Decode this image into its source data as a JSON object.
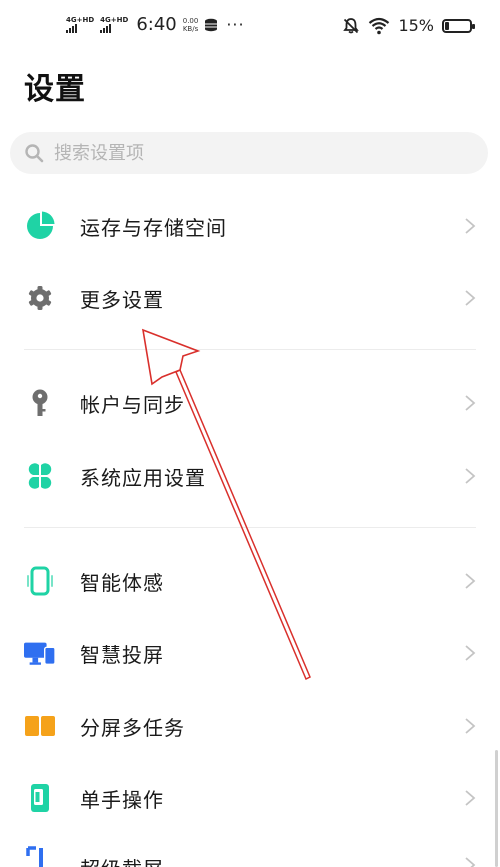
{
  "status_bar": {
    "sim1": "4G+HD",
    "sim2": "4G+HD",
    "time": "6:40",
    "speed_value": "0.00",
    "speed_unit": "KB/s",
    "more": "···",
    "battery_pct": "15%",
    "battery_level": 0.15
  },
  "page": {
    "title": "设置"
  },
  "search": {
    "placeholder": "搜索设置项"
  },
  "menu": {
    "items": [
      {
        "label": "运存与存储空间",
        "icon": "pie-chart-icon",
        "color": "#1fd3a5"
      },
      {
        "label": "更多设置",
        "icon": "gear-icon",
        "color": "#6e6e6e"
      },
      {
        "label": "帐户与同步",
        "icon": "key-icon",
        "color": "#6e6e6e"
      },
      {
        "label": "系统应用设置",
        "icon": "clover-apps-icon",
        "color": "#1fd3a5"
      },
      {
        "label": "智能体感",
        "icon": "phone-outline-icon",
        "color": "#1fd3a5"
      },
      {
        "label": "智慧投屏",
        "icon": "cast-screen-icon",
        "color": "#2f6ff0"
      },
      {
        "label": "分屏多任务",
        "icon": "split-screen-icon",
        "color": "#f5a21a"
      },
      {
        "label": "单手操作",
        "icon": "one-hand-icon",
        "color": "#1fd3a5"
      },
      {
        "label": "超级截屏",
        "icon": "screenshot-icon",
        "color": "#2f6ff0"
      }
    ]
  },
  "colors": {
    "accent_teal": "#1fd3a5",
    "accent_blue": "#2f6ff0",
    "accent_orange": "#f5a21a",
    "annotation_red": "#d9302c"
  }
}
